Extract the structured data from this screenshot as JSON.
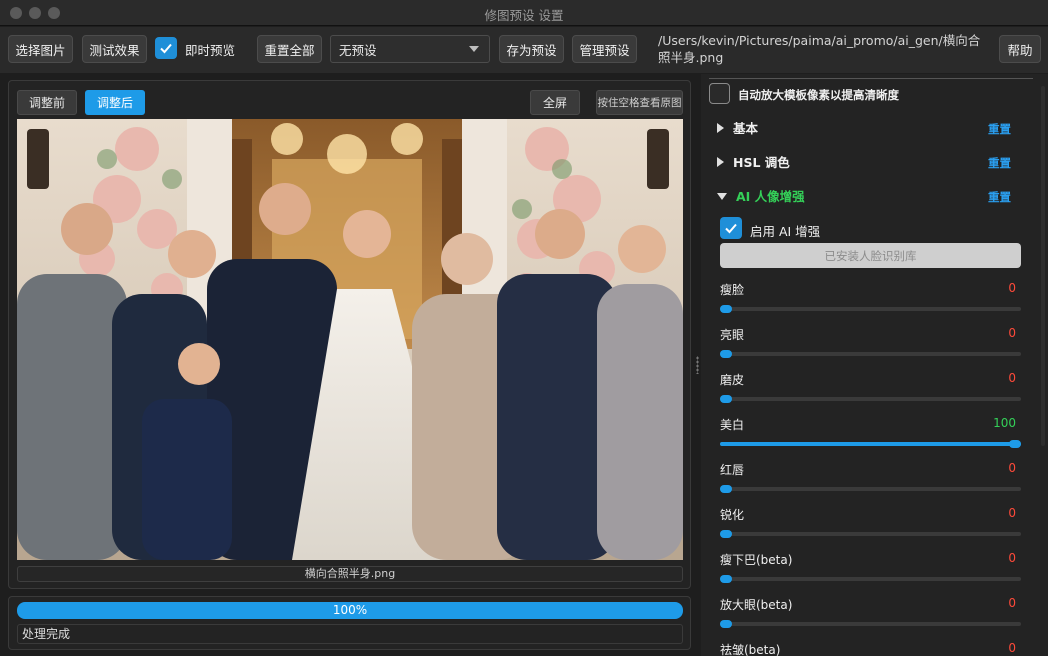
{
  "window": {
    "title": "修图预设 设置"
  },
  "toolbar": {
    "select_image": "选择图片",
    "test_effect": "测试效果",
    "live_preview": "即时预览",
    "reset_all": "重置全部",
    "preset_value": "无预设",
    "save_preset": "存为预设",
    "manage_preset": "管理预设",
    "file_path": "/Users/kevin/Pictures/paima/ai_promo/ai_gen/横向合照半身.png",
    "help": "帮助"
  },
  "preview": {
    "before_tab": "调整前",
    "after_tab": "调整后",
    "fullscreen": "全屏",
    "hold_space_hint": "按住空格查看原图",
    "filename": "横向合照半身.png"
  },
  "progress": {
    "percent_text": "100%",
    "value": 1.0,
    "status": "处理完成"
  },
  "settings": {
    "auto_upscale_label": "自动放大模板像素以提高清晰度",
    "sections": [
      {
        "label": "基本",
        "reset": "重置",
        "expanded": false
      },
      {
        "label": "HSL 调色",
        "reset": "重置",
        "expanded": false
      },
      {
        "label": "AI 人像增强",
        "reset": "重置",
        "expanded": true
      }
    ],
    "enable_ai_label": "启用 AI 增强",
    "face_lib_button": "已安装人脸识别库",
    "sliders": [
      {
        "name": "瘦脸",
        "value": "0",
        "level": 0
      },
      {
        "name": "亮眼",
        "value": "0",
        "level": 0
      },
      {
        "name": "磨皮",
        "value": "0",
        "level": 0
      },
      {
        "name": "美白",
        "value": "100",
        "level": 1
      },
      {
        "name": "红唇",
        "value": "0",
        "level": 0
      },
      {
        "name": "锐化",
        "value": "0",
        "level": 0
      },
      {
        "name": "瘦下巴(beta)",
        "value": "0",
        "level": 0
      },
      {
        "name": "放大眼(beta)",
        "value": "0",
        "level": 0
      },
      {
        "name": "祛皱(beta)",
        "value": "0",
        "level": 0
      }
    ]
  },
  "colors": {
    "accent": "#1e9be8",
    "ai_section": "#34d058",
    "zero_value": "#ff4a3a",
    "reset_link": "#2a9ff0"
  }
}
